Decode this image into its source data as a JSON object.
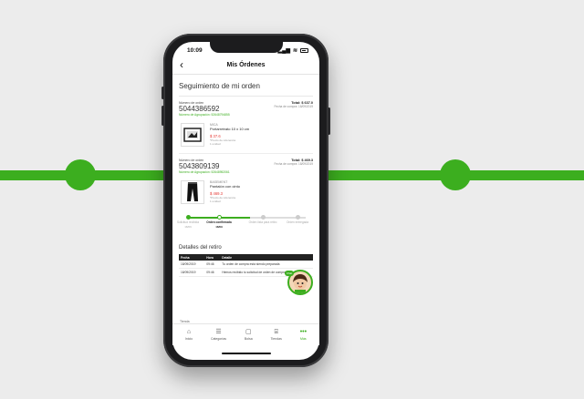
{
  "status_bar": {
    "time": "10:09",
    "signal": "▂▄▆",
    "wifi": "≋"
  },
  "nav": {
    "back_icon": "chevron-left",
    "title": "Mis Órdenes"
  },
  "section_title": "Seguimiento de mi orden",
  "orders": [
    {
      "label": "Número de orden",
      "number": "5044386592",
      "group": "Número de Agrupación: 52648794855",
      "total": "Total: $ 637.0",
      "date": "Fecha de compra: 18/09/2019",
      "product": {
        "brand": "MICA",
        "name": "Portarretrato 10 x 10 cm",
        "price": "$ 37.6",
        "ref": "*Precio de referencia",
        "qty": "1 unidad"
      }
    },
    {
      "label": "Número de orden",
      "number": "5043809139",
      "group": "Número de Agrupación: 52648952061",
      "total": "Total: $ 469.3",
      "date": "Fecha de compra: 18/09/2019",
      "product": {
        "brand": "BASEMENT",
        "name": "Pantalón con cinto",
        "price": "$ 469.3",
        "ref": "*Precio de referencia",
        "qty": "1 unidad"
      }
    }
  ],
  "tracking": [
    {
      "status": "Solicitud recibida",
      "date": "18/09"
    },
    {
      "status": "Orden confirmada",
      "date": "18/09"
    },
    {
      "status": "Orden lista para retiro",
      "date": ""
    },
    {
      "status": "Orden entregada",
      "date": ""
    }
  ],
  "detail": {
    "title": "Detalles del retiro",
    "headers": [
      "Fecha",
      "Hora",
      "Detalle"
    ],
    "rows": [
      [
        "18/09/2019",
        "09:46",
        "Tu orden de compra está siendo preparada"
      ],
      [
        "18/09/2019",
        "09:46",
        "Hemos recibido tu solicitud de orden de compra"
      ]
    ]
  },
  "chat_badge": "Chat",
  "more_label": "Tienda",
  "tabs": [
    {
      "label": "Inicio",
      "icon": "home-icon",
      "glyph": "⌂"
    },
    {
      "label": "Categorías",
      "icon": "list-icon",
      "glyph": "☰"
    },
    {
      "label": "Bolsa",
      "icon": "bag-icon",
      "glyph": "▢"
    },
    {
      "label": "Tiendas",
      "icon": "store-icon",
      "glyph": "⌸"
    },
    {
      "label": "Más",
      "icon": "more-icon",
      "glyph": "•••"
    }
  ],
  "colors": {
    "accent": "#3cae1f",
    "price": "#e53935",
    "background": "#ececec"
  }
}
